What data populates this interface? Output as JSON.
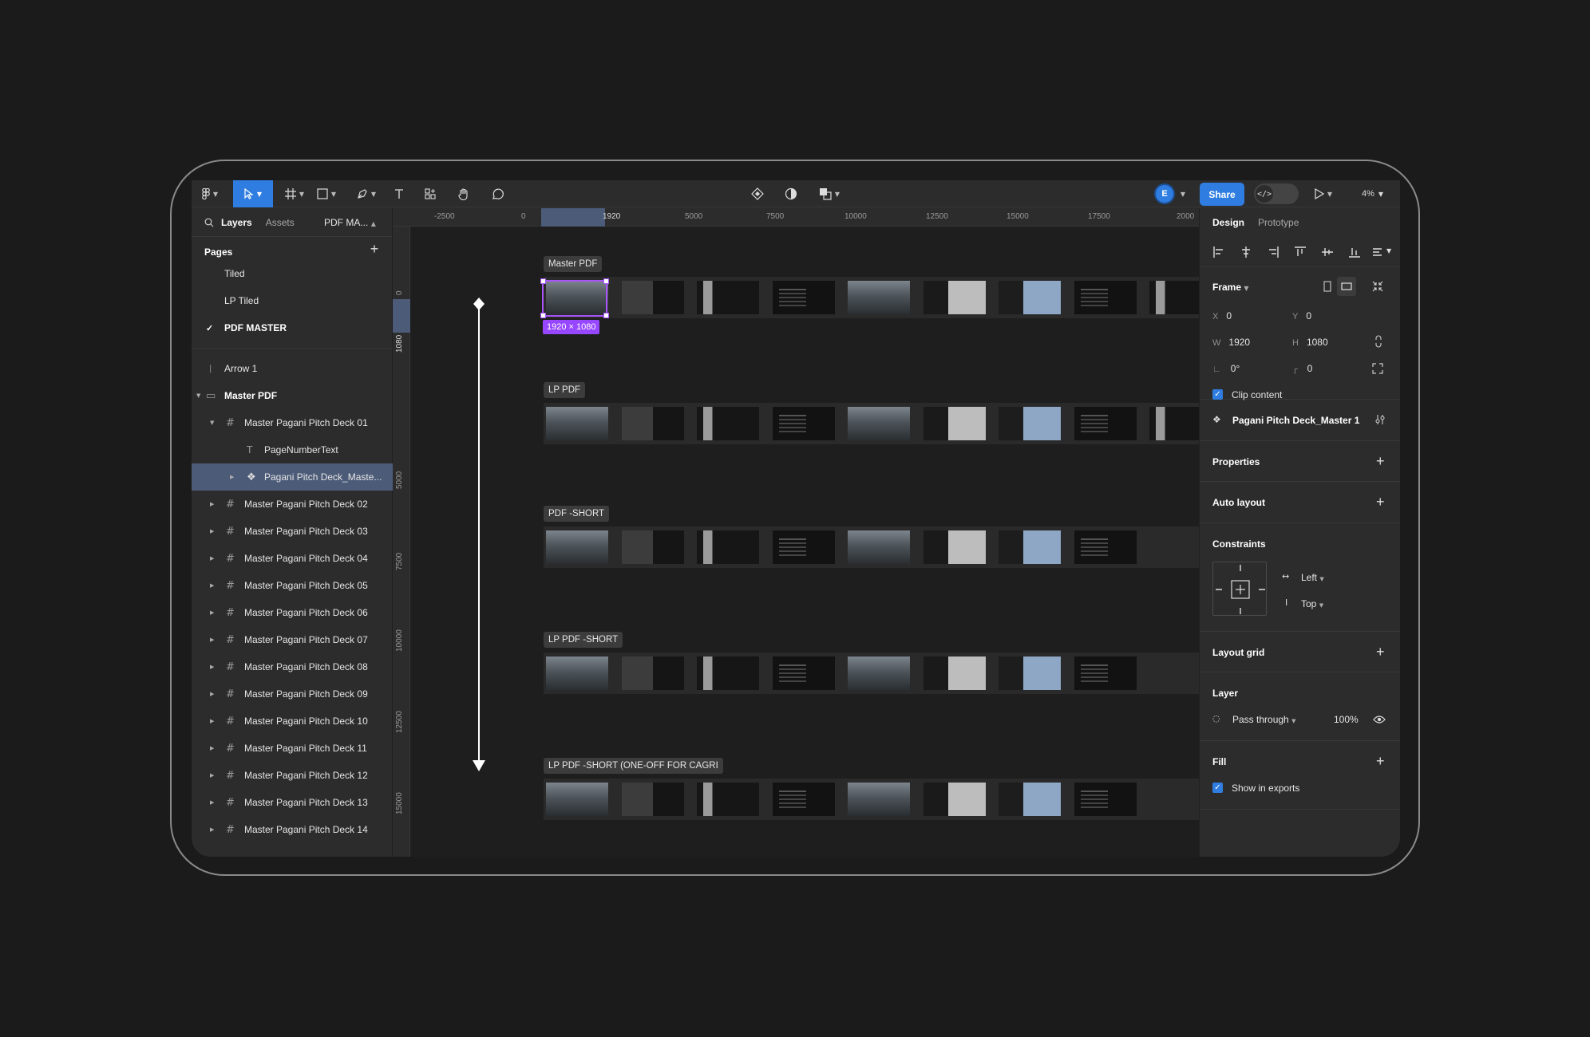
{
  "toolbar": {
    "share_label": "Share",
    "avatar_initial": "E",
    "zoom": "4%"
  },
  "left_panel": {
    "tabs": [
      "Layers",
      "Assets"
    ],
    "page_selector": "PDF MA...",
    "pages_title": "Pages",
    "pages": [
      "Tiled",
      "LP Tiled",
      "PDF MASTER"
    ],
    "layers": [
      "Arrow 1",
      "Master PDF",
      "Master Pagani Pitch Deck 01",
      "PageNumberText",
      "Pagani Pitch Deck_Maste...",
      "Master Pagani Pitch Deck 02",
      "Master Pagani Pitch Deck 03",
      "Master Pagani Pitch Deck 04",
      "Master Pagani Pitch Deck 05",
      "Master Pagani Pitch Deck 06",
      "Master Pagani Pitch Deck 07",
      "Master Pagani Pitch Deck 08",
      "Master Pagani Pitch Deck 09",
      "Master Pagani Pitch Deck 10",
      "Master Pagani Pitch Deck 11",
      "Master Pagani Pitch Deck 12",
      "Master Pagani Pitch Deck 13",
      "Master Pagani Pitch Deck 14"
    ]
  },
  "canvas": {
    "ruler_top": [
      "-2500",
      "0",
      "1920",
      "5000",
      "7500",
      "10000",
      "12500",
      "15000",
      "17500",
      "2000"
    ],
    "ruler_left": [
      "0",
      "1080",
      "5000",
      "7500",
      "10000",
      "12500",
      "15000"
    ],
    "frames": [
      "Master PDF",
      "LP PDF",
      "PDF -SHORT",
      "LP PDF -SHORT",
      "LP PDF -SHORT (ONE-OFF FOR CAGRI"
    ],
    "size_badge": "1920 × 1080"
  },
  "right_panel": {
    "tabs": [
      "Design",
      "Prototype"
    ],
    "frame_label": "Frame",
    "x": "0",
    "y": "0",
    "w": "1920",
    "h": "1080",
    "rotation": "0°",
    "radius": "0",
    "x_key": "X",
    "y_key": "Y",
    "w_key": "W",
    "h_key": "H",
    "clip_content": "Clip content",
    "component_name": "Pagani Pitch Deck_Master 1",
    "properties": "Properties",
    "auto_layout": "Auto layout",
    "constraints": "Constraints",
    "constraint_h": "Left",
    "constraint_v": "Top",
    "layout_grid": "Layout grid",
    "layer": "Layer",
    "blend": "Pass through",
    "opacity": "100%",
    "fill": "Fill",
    "show_in_exports": "Show in exports"
  },
  "colors": {
    "accent": "#2f7de1",
    "selection": "#a855f7",
    "layer_selected": "#4c5b78"
  }
}
